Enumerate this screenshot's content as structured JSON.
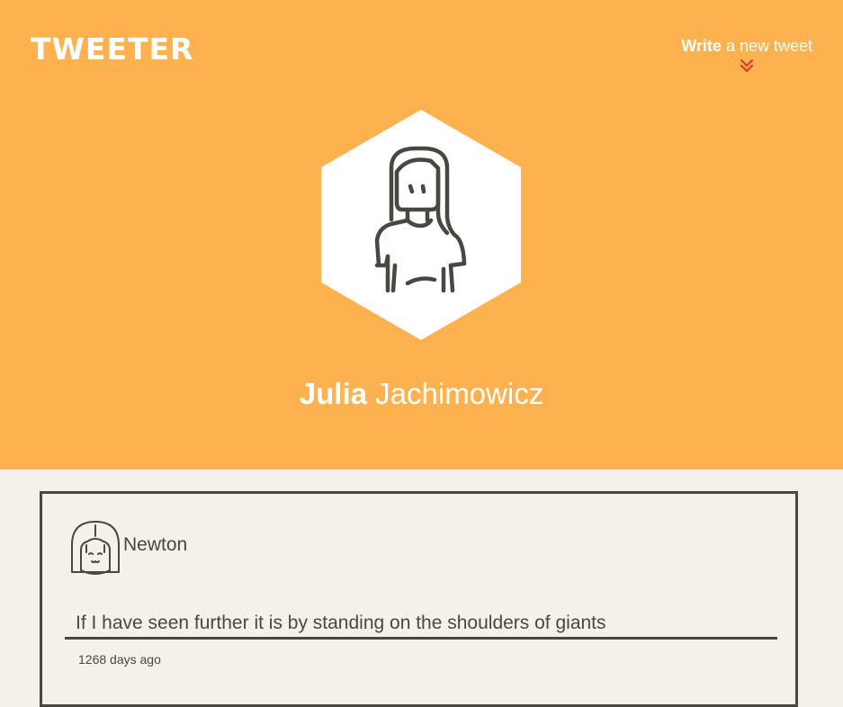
{
  "header": {
    "logo": "TWEETER",
    "compose_strong": "Write",
    "compose_rest": " a new tweet",
    "compose_icon": "double-chevron-down-icon"
  },
  "profile": {
    "first_name": "Julia",
    "last_name": "Jachimowicz",
    "avatar_icon": "woman-avatar-icon"
  },
  "tweet": {
    "author": "Newton",
    "avatar_icon": "girl-avatar-icon",
    "text": "If I have seen further it is by standing on the shoulders of giants",
    "time": "1268 days ago"
  },
  "colors": {
    "hero": "#fdb24f",
    "page": "#f4f1ea",
    "ink": "#4a4640",
    "accent": "#e8372a"
  }
}
